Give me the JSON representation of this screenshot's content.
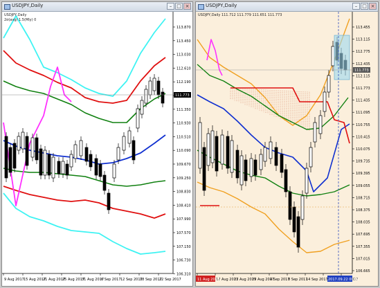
{
  "windows": [
    {
      "id": "left",
      "title": "USDJPY,Daily",
      "info_line_1": "USDJPY,Daily",
      "info_line_2": "2σ(avg) 1.5(Mly) 0",
      "price_axis": [
        "113.870",
        "113.450",
        "113.030",
        "112.610",
        "112.190",
        "111.770",
        "111.350",
        "110.930",
        "110.510",
        "110.090",
        "109.670",
        "109.250",
        "108.830",
        "108.410",
        "107.990",
        "107.570",
        "107.150",
        "106.730",
        "106.310"
      ],
      "current_price": "111.773",
      "date_axis": [
        "9 Aug 2017",
        "15 Aug 2017",
        "21 Aug 2017",
        "25 Aug 2017",
        "31 Aug 2017",
        "6 Sep 2017",
        "12 Sep 2017",
        "18 Sep 2017",
        "22 Sep 2017"
      ]
    },
    {
      "id": "right",
      "title": "USDJPY,Daily",
      "info_line_1": "USDJPY,Daily 111.712 111.779 111.651 111.773",
      "price_axis": [
        "113.455",
        "113.115",
        "112.775",
        "112.435",
        "112.115",
        "111.773",
        "111.435",
        "111.095",
        "110.755",
        "110.415",
        "110.075",
        "109.735",
        "109.395",
        "109.055",
        "108.715",
        "108.375",
        "108.035",
        "107.695",
        "107.355",
        "107.015",
        "106.665"
      ],
      "current_price": "111.773",
      "date_axis": [
        "11 Aug 2017",
        "17 Aug 2017",
        "23 Aug 2017",
        "29 Aug 2017",
        "4 Sep 2017",
        "8 Sep 2017",
        "14 Sep 2017",
        "2017.09.22 00:00",
        "Sep 2017"
      ],
      "date_axis_start_tag": "11 Aug 2017",
      "date_axis_highlight_tag": "2017.09.22 00:00"
    }
  ],
  "icons": {
    "window_icon": "chart-window-icon",
    "minimize": "minimize-icon",
    "maximize": "maximize-icon",
    "close": "close-icon"
  },
  "colors": {
    "left_bg": "#ffffff",
    "right_bg": "#fbefdc",
    "bull": "#ffffff",
    "bear": "#000000",
    "cyan": "#3ef3f3",
    "red": "#e01010",
    "green": "#108010",
    "blue": "#1030d0",
    "magenta": "#ff30ff",
    "orange": "#f0a020",
    "kijun_red": "#e01010",
    "senkou_green": "#107010",
    "cloud_hatch": "#d07050"
  }
}
